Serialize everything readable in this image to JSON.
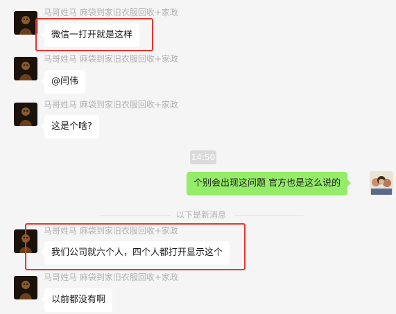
{
  "messages": [
    {
      "sender": "马哥姓马 麻袋到家旧衣服回收+家政",
      "text": "微信一打开就是这样"
    },
    {
      "sender": "马哥姓马 麻袋到家旧衣服回收+家政",
      "text": "@闫伟"
    },
    {
      "sender": "马哥姓马 麻袋到家旧衣服回收+家政",
      "text": "这是个啥?"
    },
    {
      "sender": "马哥姓马 麻袋到家旧衣服回收+家政",
      "text": "我们公司就六个人，四个人都打开显示这个"
    },
    {
      "sender": "马哥姓马 麻袋到家旧衣服回收+家政",
      "text": "以前都没有啊"
    }
  ],
  "time_separator": "14:50",
  "own_message": "个别会出现这问题  官方也是这么说的",
  "new_messages_divider": "以下是新消息",
  "colors": {
    "background": "#f5f5f5",
    "own_bubble": "#95ec69",
    "other_bubble": "#ffffff",
    "highlight": "#e8342d"
  }
}
